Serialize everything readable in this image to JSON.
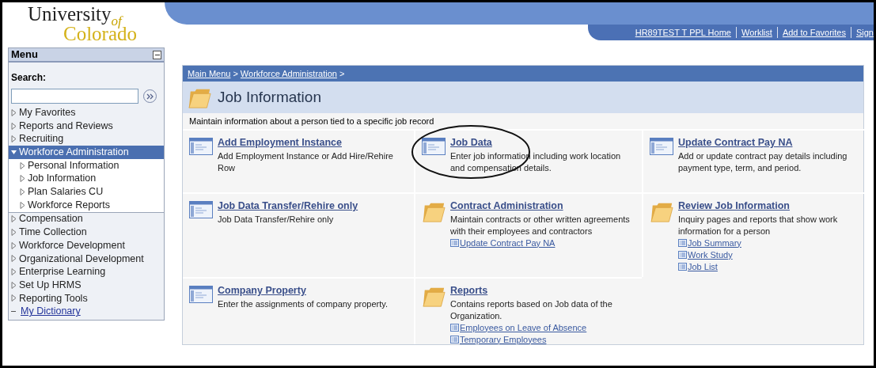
{
  "logo": {
    "name": "University",
    "suffix": "of",
    "place": "Colorado"
  },
  "header_links": [
    "HR89TEST T  PPL Home",
    "Worklist",
    "Add to Favorites",
    "Sign"
  ],
  "menu": {
    "title": "Menu",
    "search_label": "Search:",
    "items": [
      {
        "label": "My Favorites",
        "kind": "folder",
        "expanded": false,
        "selected": false
      },
      {
        "label": "Reports and Reviews",
        "kind": "folder",
        "expanded": false,
        "selected": false
      },
      {
        "label": "Recruiting",
        "kind": "folder",
        "expanded": false,
        "selected": false
      },
      {
        "label": "Workforce Administration",
        "kind": "folder",
        "expanded": true,
        "selected": true,
        "children": [
          {
            "label": "Personal Information",
            "kind": "folder",
            "expanded": false,
            "selected": false
          },
          {
            "label": "Job Information",
            "kind": "folder",
            "expanded": false,
            "selected": false
          },
          {
            "label": "Plan Salaries CU",
            "kind": "folder",
            "expanded": false,
            "selected": false
          },
          {
            "label": "Workforce Reports",
            "kind": "folder",
            "expanded": false,
            "selected": false
          }
        ]
      },
      {
        "label": "Compensation",
        "kind": "folder",
        "expanded": false,
        "selected": false
      },
      {
        "label": "Time Collection",
        "kind": "folder",
        "expanded": false,
        "selected": false
      },
      {
        "label": "Workforce Development",
        "kind": "folder",
        "expanded": false,
        "selected": false
      },
      {
        "label": "Organizational Development",
        "kind": "folder",
        "expanded": false,
        "selected": false
      },
      {
        "label": "Enterprise Learning",
        "kind": "folder",
        "expanded": false,
        "selected": false
      },
      {
        "label": "Set Up HRMS",
        "kind": "folder",
        "expanded": false,
        "selected": false
      },
      {
        "label": "Reporting Tools",
        "kind": "folder",
        "expanded": false,
        "selected": false
      },
      {
        "label": "My Dictionary",
        "kind": "link",
        "expanded": false,
        "selected": false
      }
    ]
  },
  "breadcrumb": [
    {
      "label": "Main Menu",
      "separator": ">"
    },
    {
      "label": "Workforce Administration",
      "separator": ">"
    }
  ],
  "page_title": "Job Information",
  "page_description": "Maintain information about a person tied to a specific job record",
  "tiles": [
    {
      "kind": "page",
      "title": "Add Employment Instance",
      "description": "Add Employment Instance or Add Hire/Rehire Row",
      "circled": false
    },
    {
      "kind": "page",
      "title": "Job Data",
      "description": "Enter job information including work location and compensation details.",
      "circled": true
    },
    {
      "kind": "page",
      "title": "Update Contract Pay NA",
      "description": "Add or update contract pay details including payment type, term, and period.",
      "circled": false
    },
    {
      "kind": "page",
      "title": "Job Data Transfer/Rehire only",
      "description": "Job Data Transfer/Rehire only",
      "circled": false
    },
    {
      "kind": "folder",
      "title": "Contract Administration",
      "description": "Maintain contracts or other written agreements with their employees and contractors",
      "links": [
        "Update Contract Pay NA"
      ],
      "circled": false
    },
    {
      "kind": "folder",
      "title": "Review Job Information",
      "description": "Inquiry pages and reports that show work information for a person",
      "links": [
        "Job Summary",
        "Work Study",
        "Job List"
      ],
      "circled": false
    },
    {
      "kind": "page",
      "title": "Company Property",
      "description": "Enter the assignments of company property.",
      "circled": false
    },
    {
      "kind": "folder",
      "title": "Reports",
      "description": "Contains reports based on Job data of the Organization.",
      "links": [
        "Employees on Leave of Absence",
        "Temporary Employees"
      ],
      "circled": false
    }
  ]
}
